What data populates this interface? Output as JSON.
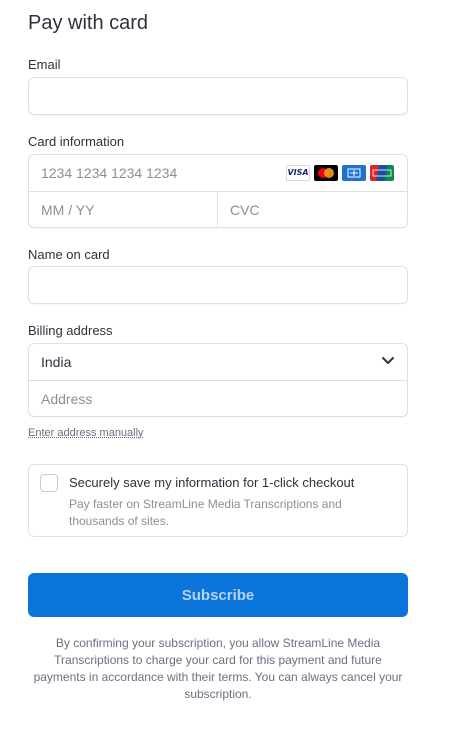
{
  "form": {
    "title": "Pay with card",
    "email": {
      "label": "Email",
      "value": "",
      "placeholder": ""
    },
    "card": {
      "label": "Card information",
      "number_placeholder": "1234 1234 1234 1234",
      "expiry_placeholder": "MM / YY",
      "cvc_placeholder": "CVC",
      "brands": [
        {
          "icon": "visa-icon",
          "text": "VISA"
        },
        {
          "icon": "mastercard-icon"
        },
        {
          "icon": "amex-icon"
        },
        {
          "icon": "unionpay-icon"
        }
      ]
    },
    "name": {
      "label": "Name on card",
      "value": ""
    },
    "billing": {
      "label": "Billing address",
      "country": "India",
      "address_placeholder": "Address",
      "manual_link": "Enter address manually"
    },
    "save": {
      "checked": false,
      "title": "Securely save my information for 1-click checkout",
      "description": "Pay faster on StreamLine Media Transcriptions and thousands of sites."
    },
    "submit_label": "Subscribe",
    "disclaimer": "By confirming your subscription, you allow StreamLine Media Transcriptions to charge your card for this payment and future payments in accordance with their terms. You can always cancel your subscription."
  },
  "colors": {
    "primary": "#0a74da",
    "text": "#30313d",
    "muted": "#8a8f98",
    "border": "#e0e0e0"
  }
}
